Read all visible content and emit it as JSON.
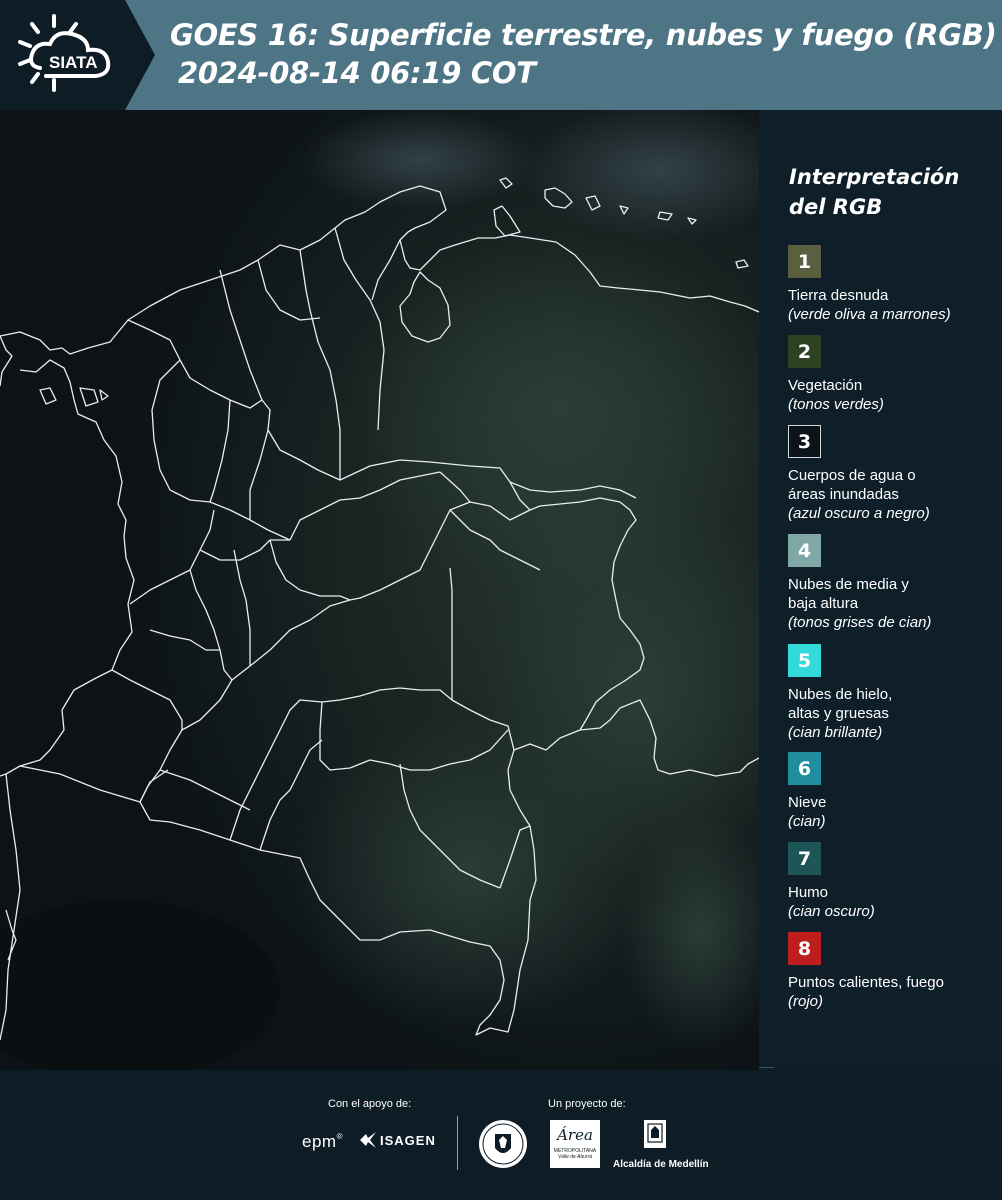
{
  "header": {
    "logo_text": "SIATA",
    "title_line1": "GOES 16: Superficie terrestre, nubes y fuego (RGB)",
    "title_line2": "2024-08-14 06:19 COT"
  },
  "legend": {
    "title_line1": "Interpretación",
    "title_line2": "del RGB",
    "items": [
      {
        "num": "1",
        "color": "#5c5e40",
        "label": "Tierra desnuda",
        "sub": "(verde oliva a marrones)"
      },
      {
        "num": "2",
        "color": "#2e4221",
        "label": "Vegetación",
        "sub": "(tonos verdes)"
      },
      {
        "num": "3",
        "color": "#0d1419",
        "label": "Cuerpos de agua o áreas inundadas",
        "sub": "(azul oscuro a negro)"
      },
      {
        "num": "4",
        "color": "#7fa8a6",
        "label": "Nubes de media y baja altura",
        "sub": "(tonos grises de cian)"
      },
      {
        "num": "5",
        "color": "#32d9d9",
        "label": "Nubes de hielo, altas y gruesas",
        "sub": "(cian brillante)"
      },
      {
        "num": "6",
        "color": "#218ea0",
        "label": "Nieve",
        "sub": "(cian)"
      },
      {
        "num": "7",
        "color": "#1e5658",
        "label": "Humo",
        "sub": "(cian oscuro)"
      },
      {
        "num": "8",
        "color": "#bf1e1e",
        "label": "Puntos calientes, fuego",
        "sub": "(rojo)"
      }
    ]
  },
  "footer": {
    "support_label": "Con el apoyo de:",
    "project_label": "Un proyecto de:",
    "sponsor1": "epm",
    "sponsor2": "ISAGEN",
    "partner1": "Área",
    "partner1_sub": "METROPOLITANA",
    "partner1_sub2": "Valle de Aburrá",
    "partner2": "Alcaldía de Medellín"
  }
}
